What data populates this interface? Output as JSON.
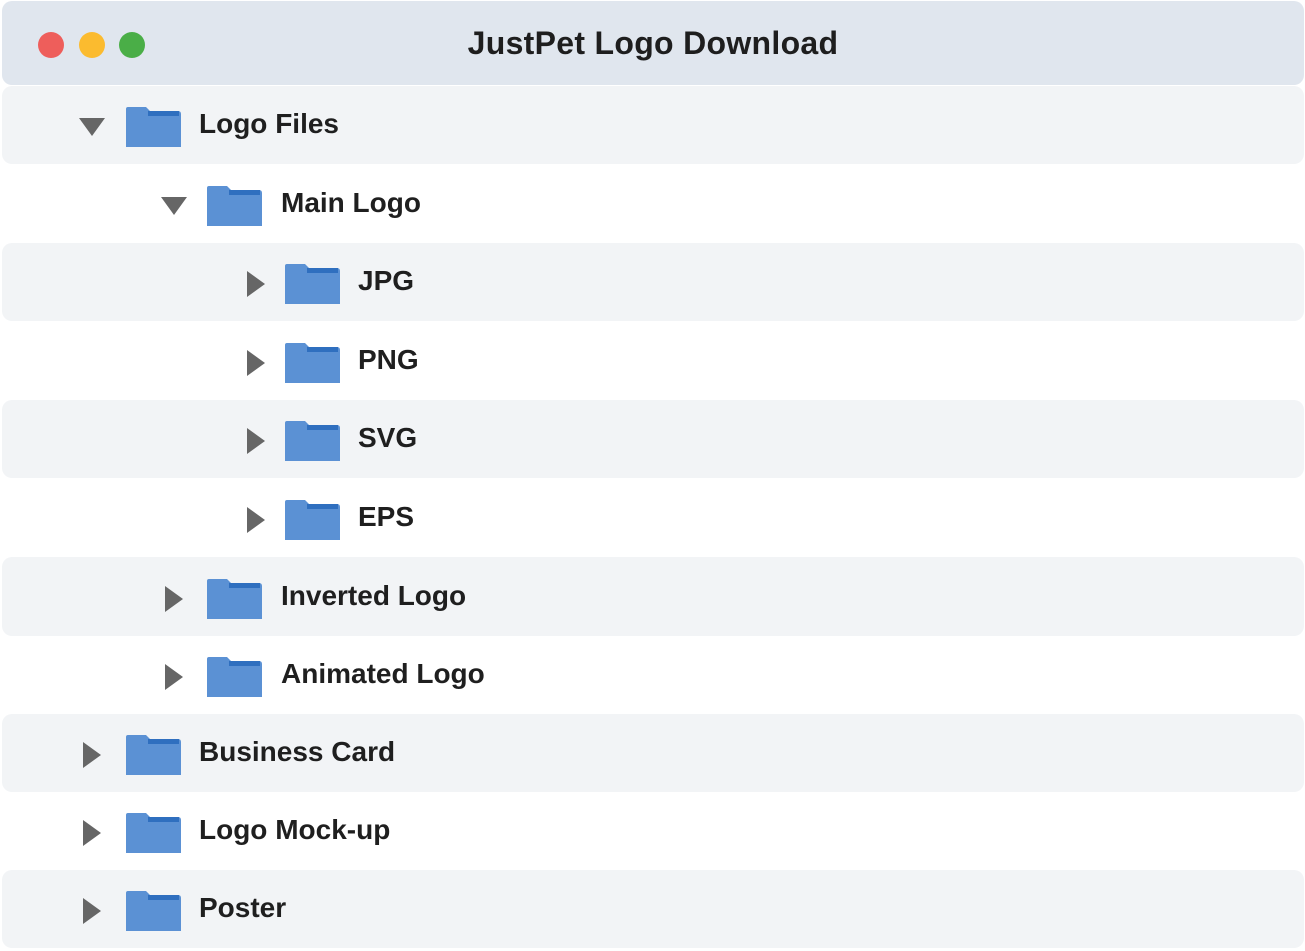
{
  "window": {
    "title": "JustPet Logo Download"
  },
  "colors": {
    "folder_fill": "#5b91d4",
    "folder_tab": "#2f6fbf",
    "arrow": "#666666",
    "row_shaded": "#f2f4f6",
    "titlebar": "#e0e6ee"
  },
  "tree": [
    {
      "label": "Logo Files",
      "level": 0,
      "expanded": true,
      "icon": "folder-icon"
    },
    {
      "label": "Main Logo",
      "level": 1,
      "expanded": true,
      "icon": "folder-icon"
    },
    {
      "label": "JPG",
      "level": 2,
      "expanded": false,
      "icon": "folder-icon"
    },
    {
      "label": "PNG",
      "level": 2,
      "expanded": false,
      "icon": "folder-icon"
    },
    {
      "label": "SVG",
      "level": 2,
      "expanded": false,
      "icon": "folder-icon"
    },
    {
      "label": "EPS",
      "level": 2,
      "expanded": false,
      "icon": "folder-icon"
    },
    {
      "label": "Inverted Logo",
      "level": 1,
      "expanded": false,
      "icon": "folder-icon"
    },
    {
      "label": "Animated Logo",
      "level": 1,
      "expanded": false,
      "icon": "folder-icon"
    },
    {
      "label": "Business Card",
      "level": 0,
      "expanded": false,
      "icon": "folder-icon"
    },
    {
      "label": "Logo Mock-up",
      "level": 0,
      "expanded": false,
      "icon": "folder-icon"
    },
    {
      "label": "Poster",
      "level": 0,
      "expanded": false,
      "icon": "folder-icon"
    }
  ]
}
